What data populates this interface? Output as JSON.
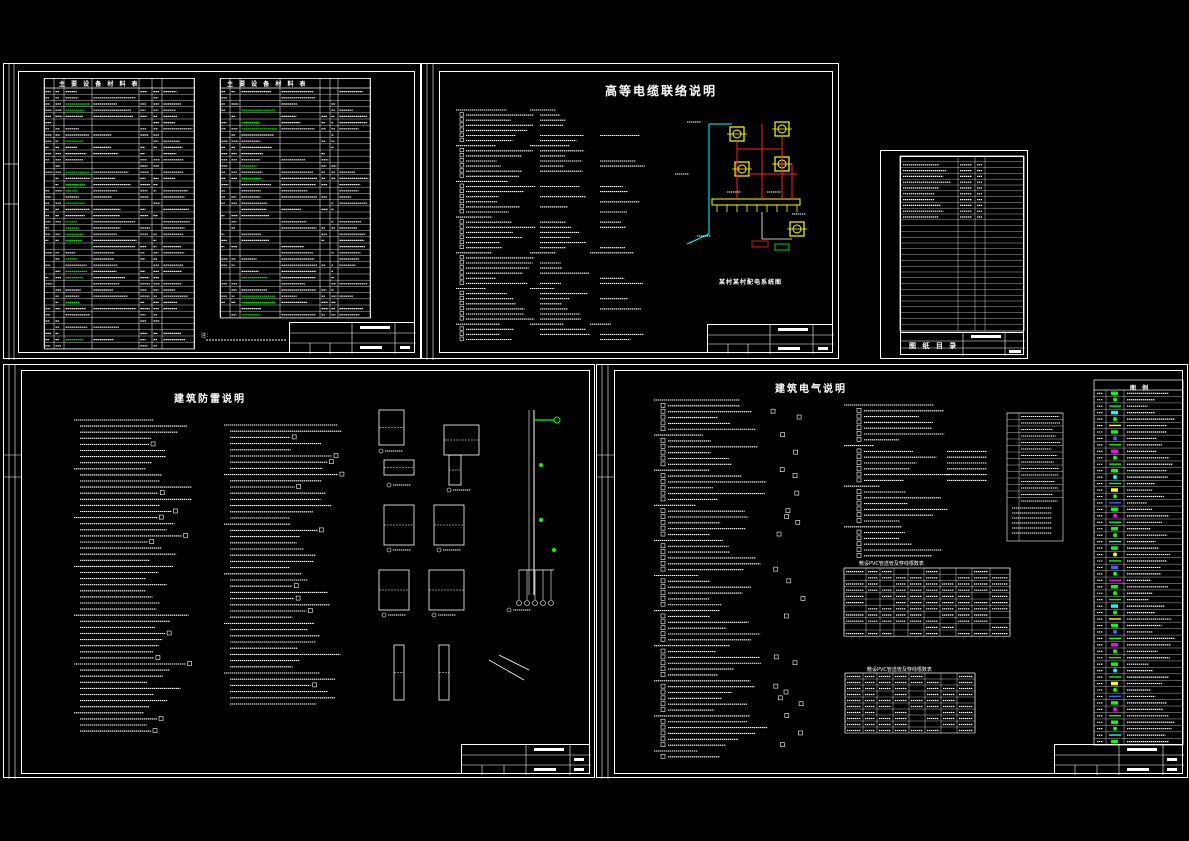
{
  "sheets": {
    "top_left": {
      "table1_title": "主 要 设 备 材 料 表",
      "table2_title": "主 要 设 备 材 料 表",
      "note": "注："
    },
    "top_middle": {
      "title": "高等电缆联络说明",
      "caption": "某村某村配电系统图"
    },
    "top_right": {
      "title": "图 纸 目 录"
    },
    "bottom_left": {
      "title": "建筑防雷说明"
    },
    "bottom_right": {
      "title": "建筑电气说明",
      "legend_title": "图 例",
      "table1_title": "敷设PVC管选管及穿线根数表",
      "table2_title": "敷设PVC管选管及穿线根数表"
    }
  },
  "colors": {
    "background": "#000000",
    "line": "#ffffff",
    "cyan": "#00ffff",
    "yellow": "#ffff00",
    "red": "#ff2020",
    "green": "#00ff00",
    "blue": "#4060ff",
    "magenta": "#ff00ff"
  }
}
